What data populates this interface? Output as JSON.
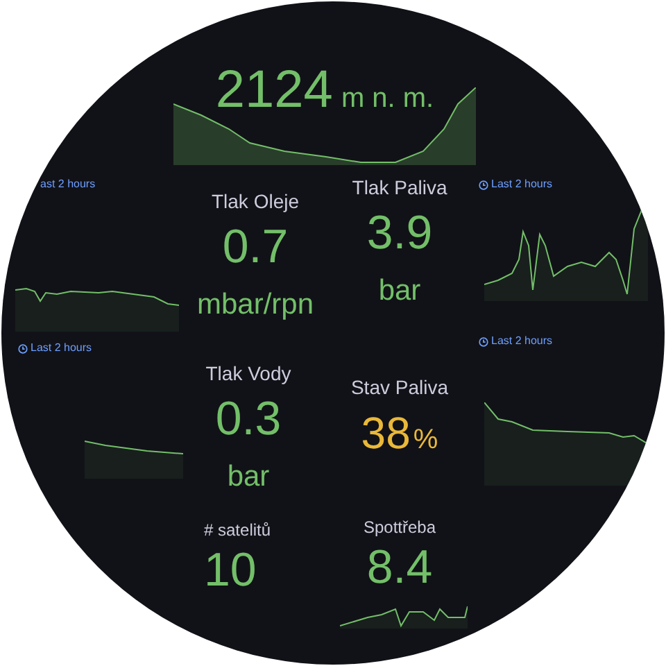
{
  "altitude": {
    "value": "2124",
    "unit": "m n. m."
  },
  "left_graphs": [
    {
      "time_range": "ast 2 hours",
      "clock": false
    },
    {
      "time_range": "Last 2 hours",
      "clock": true
    }
  ],
  "right_graphs": [
    {
      "time_range": "Last 2 hours",
      "clock": true
    },
    {
      "time_range": "Last 2 hours",
      "clock": true
    }
  ],
  "stat_columns": [
    [
      {
        "kind": "unit_below",
        "label": "Tlak Oleje",
        "value": "0.7",
        "unit": "mbar/rpn",
        "color": "#73bf69"
      },
      {
        "kind": "unit_below",
        "label": "Tlak Vody",
        "value": "0.3",
        "unit": "bar",
        "color": "#73bf69"
      },
      {
        "kind": "small",
        "label": "# satelitů",
        "value": "10",
        "color": "#73bf69"
      }
    ],
    [
      {
        "kind": "unit_below",
        "label": "Tlak Paliva",
        "value": "3.9",
        "unit": "bar",
        "color": "#73bf69"
      },
      {
        "kind": "unit_inline",
        "label": "Stav Paliva",
        "value": "38",
        "unit": "%",
        "color": "#eab839"
      },
      {
        "kind": "small",
        "label": "Spottřeba",
        "value": "8.4",
        "color": "#73bf69"
      }
    ]
  ]
}
